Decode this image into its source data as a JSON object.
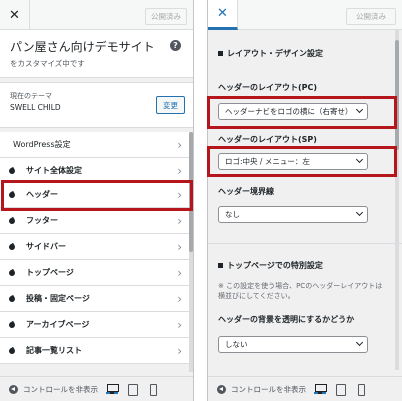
{
  "left_panel": {
    "close_symbol": "✕",
    "publish_label": "公開済み",
    "site_title": "パン屋さん向けデモサイト",
    "site_subtitle": "をカスタマイズ中です",
    "help_symbol": "?",
    "theme_label": "現在のテーマ",
    "theme_name": "SWELL CHILD",
    "change_label": "変更",
    "menu_items": [
      {
        "label": "WordPress設定",
        "icon": "none"
      },
      {
        "label": "サイト全体設定",
        "icon": "swell-leaf-icon"
      },
      {
        "label": "ヘッダー",
        "icon": "swell-leaf-icon"
      },
      {
        "label": "フッター",
        "icon": "swell-leaf-icon"
      },
      {
        "label": "サイドバー",
        "icon": "swell-leaf-icon"
      },
      {
        "label": "トップページ",
        "icon": "swell-leaf-icon"
      },
      {
        "label": "投稿・固定ページ",
        "icon": "swell-leaf-icon"
      },
      {
        "label": "アーカイブページ",
        "icon": "swell-leaf-icon"
      },
      {
        "label": "記事一覧リスト",
        "icon": "swell-leaf-icon"
      }
    ],
    "chevron_symbol": "›",
    "hide_controls_label": "コントロールを非表示"
  },
  "right_panel": {
    "close_symbol": "✕",
    "publish_label": "公開済み",
    "section_layout_title": "レイアウト・デザイン設定",
    "pc_layout_label": "ヘッダーのレイアウト(PC)",
    "pc_layout_value": "ヘッダーナビをロゴの横に（右寄せ）",
    "sp_layout_label": "ヘッダーのレイアウト(SP)",
    "sp_layout_value": "ロゴ:中央 / メニュー：左",
    "border_label": "ヘッダー境界線",
    "border_value": "なし",
    "section_top_title": "トップページでの特別設定",
    "note_text": "※ この設定を使う場合、PCのヘッダーレイアウトは横並びにしてください。",
    "transparent_label": "ヘッダーの背景を透明にするかどうか",
    "transparent_value": "しない",
    "hide_controls_label": "コントロールを非表示"
  },
  "colors": {
    "highlight": "#b4161b",
    "accent": "#2271b1"
  }
}
